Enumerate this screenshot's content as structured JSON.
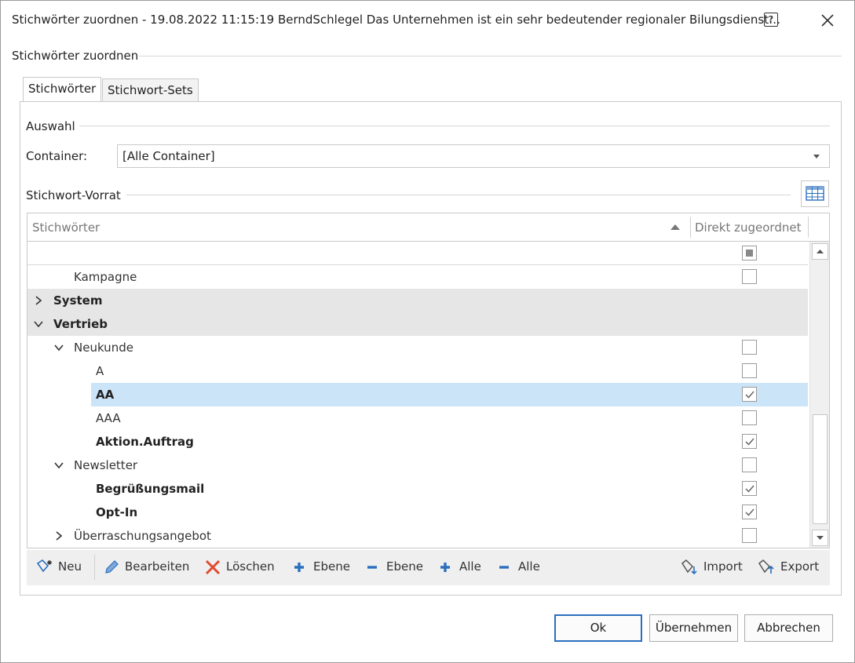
{
  "window": {
    "title": "Stichwörter zuordnen - 19.08.2022 11:15:19 BerndSchlegel Das Unternehmen ist ein sehr bedeutender regionaler Bilungsdienst…",
    "help_glyph": "?"
  },
  "group_main": {
    "label": "Stichwörter zuordnen"
  },
  "tabs": [
    {
      "label": "Stichwörter",
      "active": true
    },
    {
      "label": "Stichwort-Sets",
      "active": false
    }
  ],
  "selection": {
    "group_label": "Auswahl",
    "container_label": "Container:",
    "container_value": "[Alle Container]"
  },
  "pool": {
    "group_label": "Stichwort-Vorrat"
  },
  "grid": {
    "columns": [
      "Stichwörter",
      "Direkt zugeordnet"
    ],
    "sort": "ascending",
    "rows": [
      {
        "label": "Kampagne",
        "level": 1,
        "bold": false,
        "expander": "none",
        "group": false,
        "checked": false,
        "selected": false
      },
      {
        "label": "System",
        "level": 0,
        "bold": true,
        "expander": "collapsed",
        "group": true,
        "checked": null,
        "selected": false
      },
      {
        "label": "Vertrieb",
        "level": 0,
        "bold": true,
        "expander": "expanded",
        "group": true,
        "checked": null,
        "selected": false
      },
      {
        "label": "Neukunde",
        "level": 1,
        "bold": false,
        "expander": "expanded",
        "group": false,
        "checked": false,
        "selected": false
      },
      {
        "label": "A",
        "level": 2,
        "bold": false,
        "expander": "none",
        "group": false,
        "checked": false,
        "selected": false
      },
      {
        "label": "AA",
        "level": 2,
        "bold": true,
        "expander": "none",
        "group": false,
        "checked": true,
        "selected": true
      },
      {
        "label": "AAA",
        "level": 2,
        "bold": false,
        "expander": "none",
        "group": false,
        "checked": false,
        "selected": false
      },
      {
        "label": "Aktion.Auftrag",
        "level": 2,
        "bold": true,
        "expander": "none",
        "group": false,
        "checked": true,
        "selected": false
      },
      {
        "label": "Newsletter",
        "level": 1,
        "bold": false,
        "expander": "expanded",
        "group": false,
        "checked": false,
        "selected": false
      },
      {
        "label": "Begrüßungsmail",
        "level": 2,
        "bold": true,
        "expander": "none",
        "group": false,
        "checked": true,
        "selected": false
      },
      {
        "label": "Opt-In",
        "level": 2,
        "bold": true,
        "expander": "none",
        "group": false,
        "checked": true,
        "selected": false
      },
      {
        "label": "Überraschungsangebot",
        "level": 1,
        "bold": false,
        "expander": "collapsed",
        "group": false,
        "checked": false,
        "selected": false
      }
    ]
  },
  "toolbar": {
    "new": "Neu",
    "edit": "Bearbeiten",
    "delete": "Löschen",
    "level_plus": "Ebene",
    "level_minus": "Ebene",
    "all_plus": "Alle",
    "all_minus": "Alle",
    "import": "Import",
    "export": "Export"
  },
  "buttons": {
    "ok": "Ok",
    "apply": "Übernehmen",
    "cancel": "Abbrechen"
  },
  "colors": {
    "selection": "#cce4f7",
    "group_row": "#e6e6e6",
    "accent_blue": "#2a6fbe",
    "delete_red": "#e04a2f"
  }
}
